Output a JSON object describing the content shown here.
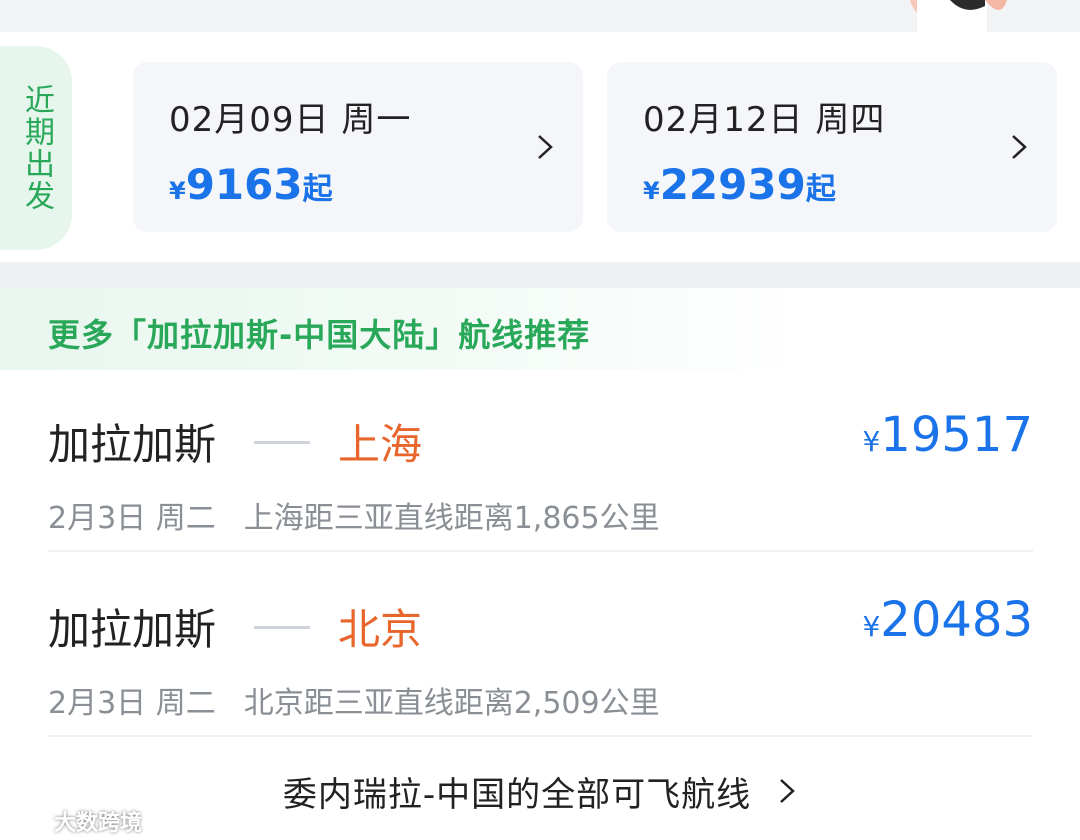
{
  "recent": {
    "tab_label": "近期出发",
    "cards": [
      {
        "date": "02月09日 周一",
        "price_symbol": "¥",
        "price": "9163",
        "price_suffix": "起"
      },
      {
        "date": "02月12日 周四",
        "price_symbol": "¥",
        "price": "22939",
        "price_suffix": "起"
      }
    ]
  },
  "recommend": {
    "title": "更多「加拉加斯-中国大陆」航线推荐",
    "routes": [
      {
        "origin": "加拉加斯",
        "destination": "上海",
        "price_symbol": "¥",
        "price": "19517",
        "date": "2月3日 周二",
        "distance_note": "上海距三亚直线距离1,865公里"
      },
      {
        "origin": "加拉加斯",
        "destination": "北京",
        "price_symbol": "¥",
        "price": "20483",
        "date": "2月3日 周二",
        "distance_note": "北京距三亚直线距离2,509公里"
      }
    ]
  },
  "all_routes": {
    "label": "委内瑞拉-中国的全部可飞航线"
  },
  "watermark": {
    "text": "大数跨境"
  },
  "colors": {
    "accent_blue": "#1a73e8",
    "accent_green": "#2aa85a",
    "destination_orange": "#e8652b"
  }
}
